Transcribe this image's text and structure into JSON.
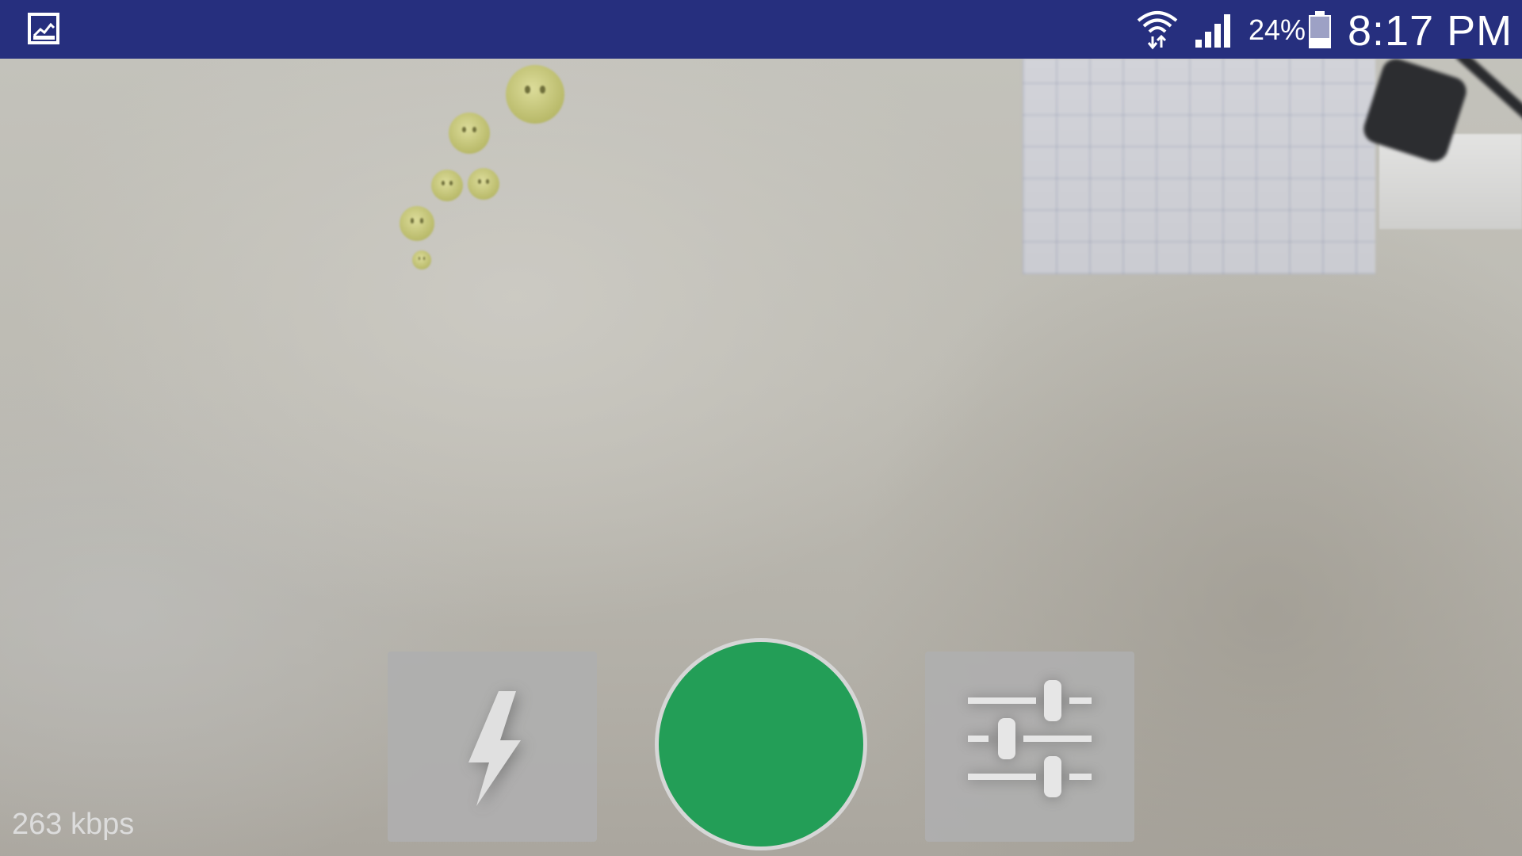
{
  "status_bar": {
    "notification_icon": "gallery-image-icon",
    "wifi_icon": "wifi-data-icon",
    "signal_icon": "cell-signal-icon",
    "battery_percent": "24%",
    "battery_icon": "battery-icon",
    "time": "8:17 PM",
    "background_color": "#262f7e"
  },
  "controls": {
    "flash_icon": "flash-icon",
    "record_icon": "record-icon",
    "record_color": "#239e57",
    "settings_icon": "sliders-settings-icon"
  },
  "stream": {
    "bitrate": "263 kbps"
  }
}
